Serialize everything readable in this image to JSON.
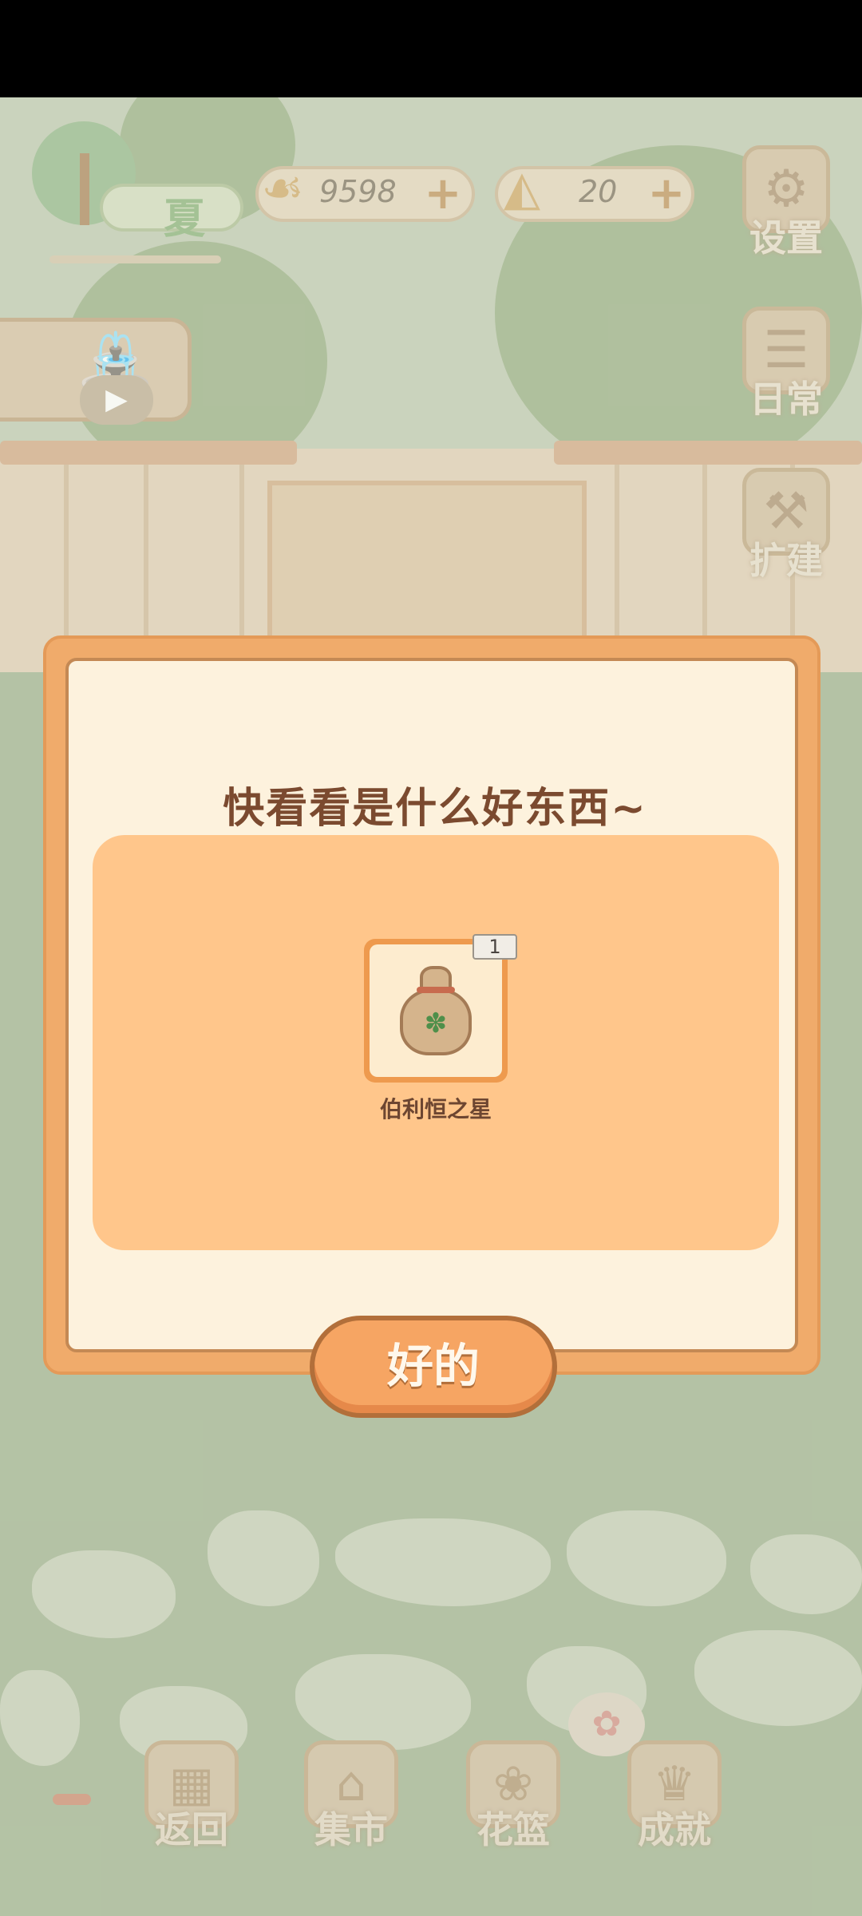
{
  "hud": {
    "season_label": "夏",
    "fish_count": "9598",
    "cheese_count": "20",
    "plus_symbol": "+",
    "settings_label": "设置",
    "daily_label": "日常",
    "expand_label": "扩建"
  },
  "dialog": {
    "title": "快看看是什么好东西~",
    "reward": {
      "name": "伯利恒之星",
      "quantity": "1"
    },
    "confirm_label": "好的"
  },
  "bottom_nav": {
    "items": [
      {
        "label": "返回",
        "icon": "window-icon"
      },
      {
        "label": "集市",
        "icon": "market-stall-icon"
      },
      {
        "label": "花篮",
        "icon": "flower-basket-icon"
      },
      {
        "label": "成就",
        "icon": "trophy-icon"
      }
    ]
  },
  "colors": {
    "dialog_border": "#f0ab6b",
    "dialog_bg": "#fdf2dd",
    "reward_panel": "#ffc68b",
    "title_text": "#7b4a2f",
    "button_bg": "#f6a563"
  }
}
